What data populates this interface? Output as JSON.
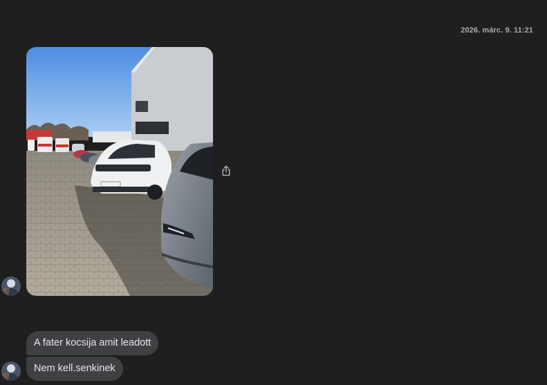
{
  "conversation": {
    "timestamp": "2026. márc. 9. 11:21",
    "photo_message": {
      "alt": "Photo message",
      "share_icon": "share-icon"
    },
    "sender_avatar_icon": "avatar",
    "messages": [
      {
        "text": "A fater kocsija amit leadott"
      },
      {
        "text": "Nem kell.senkinek"
      }
    ]
  },
  "colors": {
    "background": "#1f1f1f",
    "bubble": "#3e4042",
    "text": "#e4e6eb",
    "timestamp": "#a8abaf"
  }
}
